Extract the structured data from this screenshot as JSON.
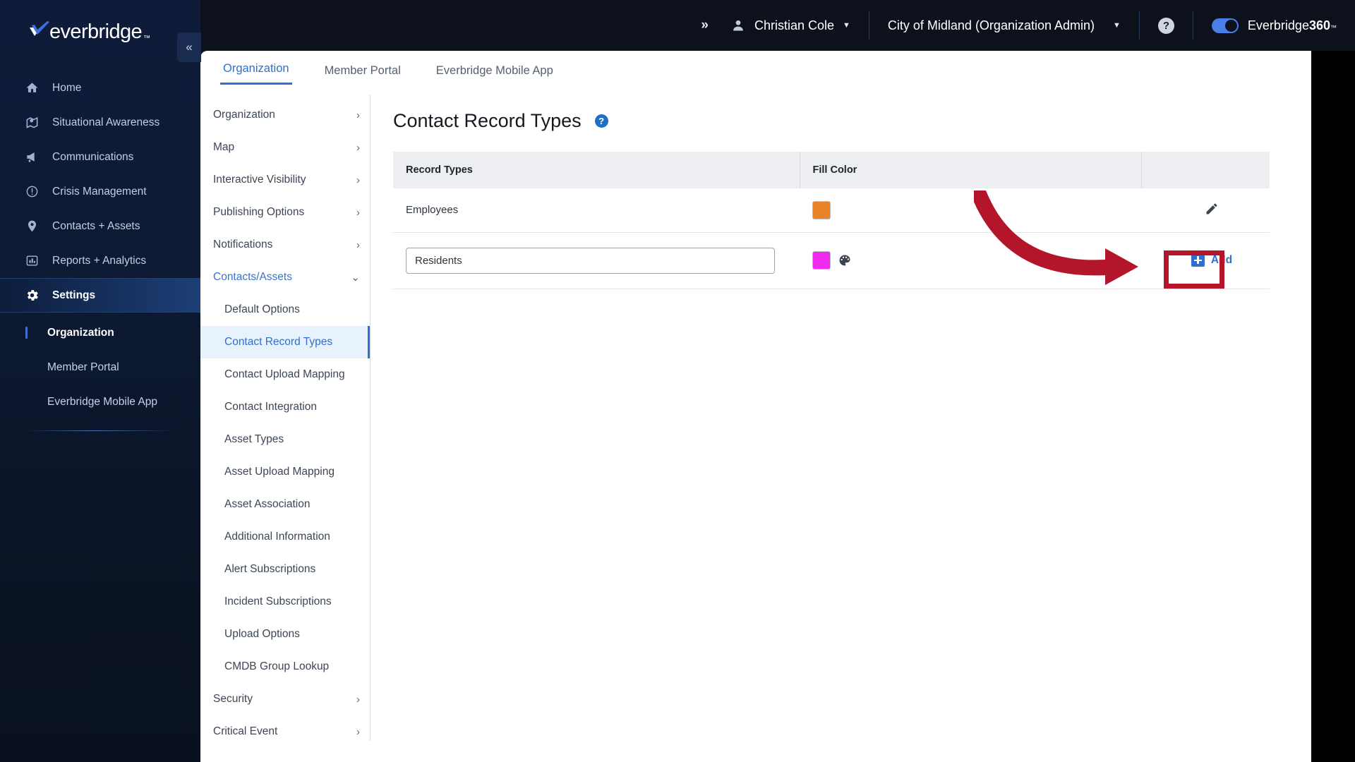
{
  "brand": {
    "name": "everbridge",
    "tm": "™"
  },
  "sidebar": {
    "collapse_icon": "double-chevron-left",
    "items": [
      {
        "label": "Home",
        "icon": "home-icon",
        "active": false
      },
      {
        "label": "Situational Awareness",
        "icon": "map-pin-icon",
        "active": false
      },
      {
        "label": "Communications",
        "icon": "megaphone-icon",
        "active": false
      },
      {
        "label": "Crisis Management",
        "icon": "alert-circle-icon",
        "active": false
      },
      {
        "label": "Contacts + Assets",
        "icon": "location-pin-icon",
        "active": false
      },
      {
        "label": "Reports + Analytics",
        "icon": "bar-chart-icon",
        "active": false
      },
      {
        "label": "Settings",
        "icon": "gear-icon",
        "active": true
      }
    ],
    "subitems": [
      {
        "label": "Organization",
        "current": true
      },
      {
        "label": "Member Portal",
        "current": false
      },
      {
        "label": "Everbridge Mobile App",
        "current": false
      }
    ]
  },
  "topbar": {
    "expand_icon": "double-chevron-right",
    "user": "Christian Cole",
    "organization": "City of Midland (Organization Admin)",
    "help_label": "?",
    "toggle_on": true,
    "product": "Everbridge ",
    "product_bold": "360",
    "product_tm": "™"
  },
  "tabs": [
    {
      "label": "Organization",
      "active": true
    },
    {
      "label": "Member Portal",
      "active": false
    },
    {
      "label": "Everbridge Mobile App",
      "active": false
    }
  ],
  "settings_nav": [
    {
      "label": "Organization",
      "type": "group",
      "chevron": "chevron-right-icon"
    },
    {
      "label": "Map",
      "type": "group",
      "chevron": "chevron-right-icon"
    },
    {
      "label": "Interactive Visibility",
      "type": "group",
      "chevron": "chevron-right-icon"
    },
    {
      "label": "Publishing Options",
      "type": "group",
      "chevron": "chevron-right-icon"
    },
    {
      "label": "Notifications",
      "type": "group",
      "chevron": "chevron-right-icon"
    },
    {
      "label": "Contacts/Assets",
      "type": "group",
      "chevron": "chevron-down-icon",
      "expanded": true
    },
    {
      "label": "Default Options",
      "type": "sub"
    },
    {
      "label": "Contact Record Types",
      "type": "sub",
      "selected": true
    },
    {
      "label": "Contact Upload Mapping",
      "type": "sub"
    },
    {
      "label": "Contact Integration",
      "type": "sub"
    },
    {
      "label": "Asset Types",
      "type": "sub"
    },
    {
      "label": "Asset Upload Mapping",
      "type": "sub"
    },
    {
      "label": "Asset Association",
      "type": "sub"
    },
    {
      "label": "Additional Information",
      "type": "sub"
    },
    {
      "label": "Alert Subscriptions",
      "type": "sub"
    },
    {
      "label": "Incident Subscriptions",
      "type": "sub"
    },
    {
      "label": "Upload Options",
      "type": "sub"
    },
    {
      "label": "CMDB Group Lookup",
      "type": "sub"
    },
    {
      "label": "Security",
      "type": "group",
      "chevron": "chevron-right-icon"
    },
    {
      "label": "Critical Event",
      "type": "group",
      "chevron": "chevron-right-icon"
    }
  ],
  "main": {
    "title": "Contact Record Types",
    "help_badge": "?",
    "table": {
      "columns": [
        "Record Types",
        "Fill Color",
        ""
      ],
      "rows": [
        {
          "name": "Employees",
          "fill_color": "#e8832a",
          "action_icon": "pencil-icon"
        }
      ],
      "edit_row": {
        "input_value": "Residents",
        "input_placeholder": "",
        "fill_color": "#ee2aee",
        "palette_icon": "palette-icon",
        "add_label": "Add",
        "add_icon": "plus-square-icon"
      }
    }
  },
  "annotation": {
    "shape": "red-arrow-and-box",
    "color": "#b3152b",
    "target": "Add"
  },
  "colors": {
    "accent_blue": "#2f6fd0",
    "sidebar_dark": "#0e1c3a",
    "topbar_dark": "#0c111c",
    "annotation_red": "#b3152b"
  }
}
